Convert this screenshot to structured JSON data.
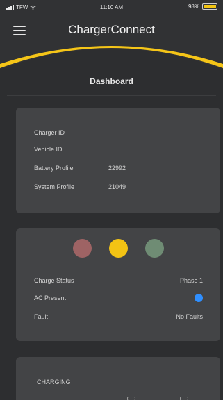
{
  "status_bar": {
    "carrier": "TFW",
    "time": "11:10 AM",
    "battery_percent": "98%",
    "battery_level": 0.98,
    "battery_color": "#f3c514"
  },
  "header": {
    "menu_icon": "hamburger-menu-icon",
    "title": "ChargerConnect",
    "accent_color": "#f5c518"
  },
  "dashboard": {
    "title": "Dashboard"
  },
  "info_card": {
    "items": [
      {
        "label": "Charger ID",
        "value": ""
      },
      {
        "label": "Vehicle ID",
        "value": ""
      },
      {
        "label": "Battery Profile",
        "value": "22992"
      },
      {
        "label": "System Profile",
        "value": "21049"
      }
    ]
  },
  "status_card": {
    "indicator_colors": [
      "#9e6364",
      "#f3c314",
      "#6f8c74"
    ],
    "rows": [
      {
        "label": "Charge Status",
        "value": "Phase 1"
      },
      {
        "label": "AC Present",
        "value": "",
        "indicator_color": "#2f8fff"
      },
      {
        "label": "Fault",
        "value": "No Faults"
      }
    ]
  },
  "charging_card": {
    "title": "CHARGING"
  }
}
